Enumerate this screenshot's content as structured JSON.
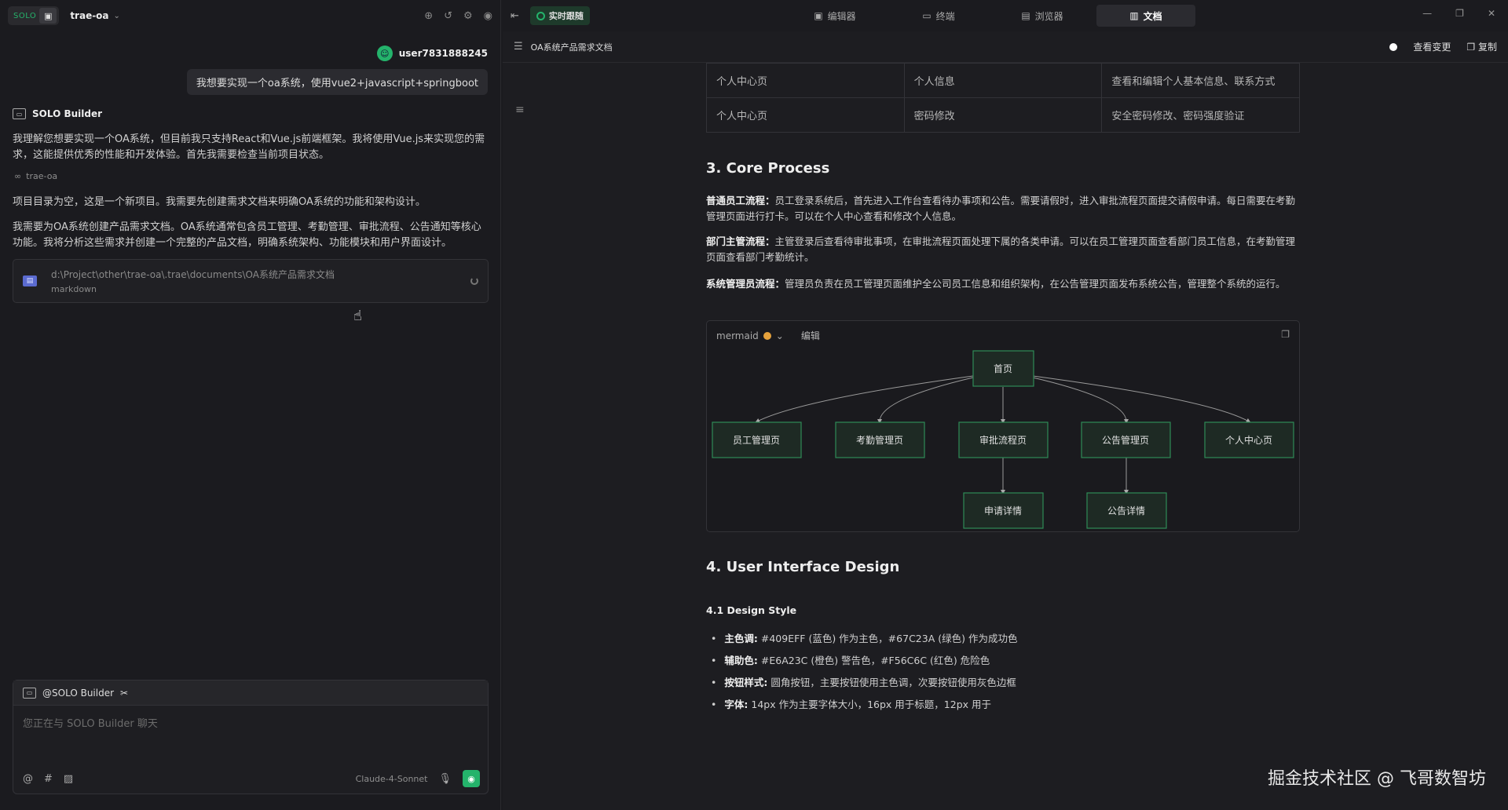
{
  "left": {
    "solo_badge": "SOLO",
    "project": "trae-oa",
    "user": {
      "avatar": "☺",
      "name": "user7831888245",
      "message": "我想要实现一个oa系统，使用vue2+javascript+springboot"
    },
    "bot": {
      "name": "SOLO Builder",
      "p1": "我理解您想要实现一个OA系统，但目前我只支持React和Vue.js前端框架。我将使用Vue.js来实现您的需求，这能提供优秀的性能和开发体验。首先我需要检查当前项目状态。",
      "tag": "trae-oa",
      "p2": "项目目录为空，这是一个新项目。我需要先创建需求文档来明确OA系统的功能和架构设计。",
      "p3": "我需要为OA系统创建产品需求文档。OA系统通常包含员工管理、考勤管理、审批流程、公告通知等核心功能。我将分析这些需求并创建一个完整的产品文档，明确系统架构、功能模块和用户界面设计。"
    },
    "file_card": {
      "path": "d:\\Project\\other\\trae-oa\\.trae\\documents\\OA系统产品需求文档",
      "type": "markdown"
    },
    "composer": {
      "mention": "@SOLO Builder",
      "placeholder": "您正在与 SOLO Builder 聊天",
      "model": "Claude-4-Sonnet"
    }
  },
  "right": {
    "live_label": "实时跟随",
    "tabs": [
      {
        "label": "编辑器",
        "icon": "editor-icon"
      },
      {
        "label": "终端",
        "icon": "terminal-icon"
      },
      {
        "label": "浏览器",
        "icon": "browser-icon"
      },
      {
        "label": "文档",
        "icon": "document-icon"
      }
    ],
    "doc_title": "OA系统产品需求文档",
    "actions": {
      "view_changes": "查看变更",
      "copy": "复制"
    },
    "table_rows": [
      [
        "个人中心页",
        "个人信息",
        "查看和编辑个人基本信息、联系方式"
      ],
      [
        "个人中心页",
        "密码修改",
        "安全密码修改、密码强度验证"
      ]
    ],
    "section3": {
      "title": "3. Core Process",
      "p1_label": "普通员工流程：",
      "p1": "员工登录系统后，首先进入工作台查看待办事项和公告。需要请假时，进入审批流程页面提交请假申请。每日需要在考勤管理页面进行打卡。可以在个人中心查看和修改个人信息。",
      "p2_label": "部门主管流程：",
      "p2": "主管登录后查看待审批事项，在审批流程页面处理下属的各类申请。可以在员工管理页面查看部门员工信息，在考勤管理页面查看部门考勤统计。",
      "p3_label": "系统管理员流程：",
      "p3": "管理员负责在员工管理页面维护全公司员工信息和组织架构，在公告管理页面发布系统公告，管理整个系统的运行。"
    },
    "mermaid": {
      "label": "mermaid",
      "edit": "编辑",
      "nodes": {
        "home": "首页",
        "emp": "员工管理页",
        "att": "考勤管理页",
        "appr": "审批流程页",
        "notice": "公告管理页",
        "me": "个人中心页",
        "apply": "申请详情",
        "ndetail": "公告详情"
      }
    },
    "section4": {
      "title": "4. User Interface Design",
      "sub": "4.1 Design Style",
      "bullets": [
        {
          "label": "主色调:",
          "text": "#409EFF (蓝色) 作为主色，#67C23A (绿色) 作为成功色"
        },
        {
          "label": "辅助色:",
          "text": "#E6A23C (橙色) 警告色，#F56C6C (红色) 危险色"
        },
        {
          "label": "按钮样式:",
          "text": "圆角按钮，主要按钮使用主色调，次要按钮使用灰色边框"
        },
        {
          "label": "字体:",
          "text": "14px 作为主要字体大小，16px 用于标题，12px 用于"
        }
      ]
    },
    "watermark": "掘金技术社区 @ 飞哥数智坊"
  }
}
